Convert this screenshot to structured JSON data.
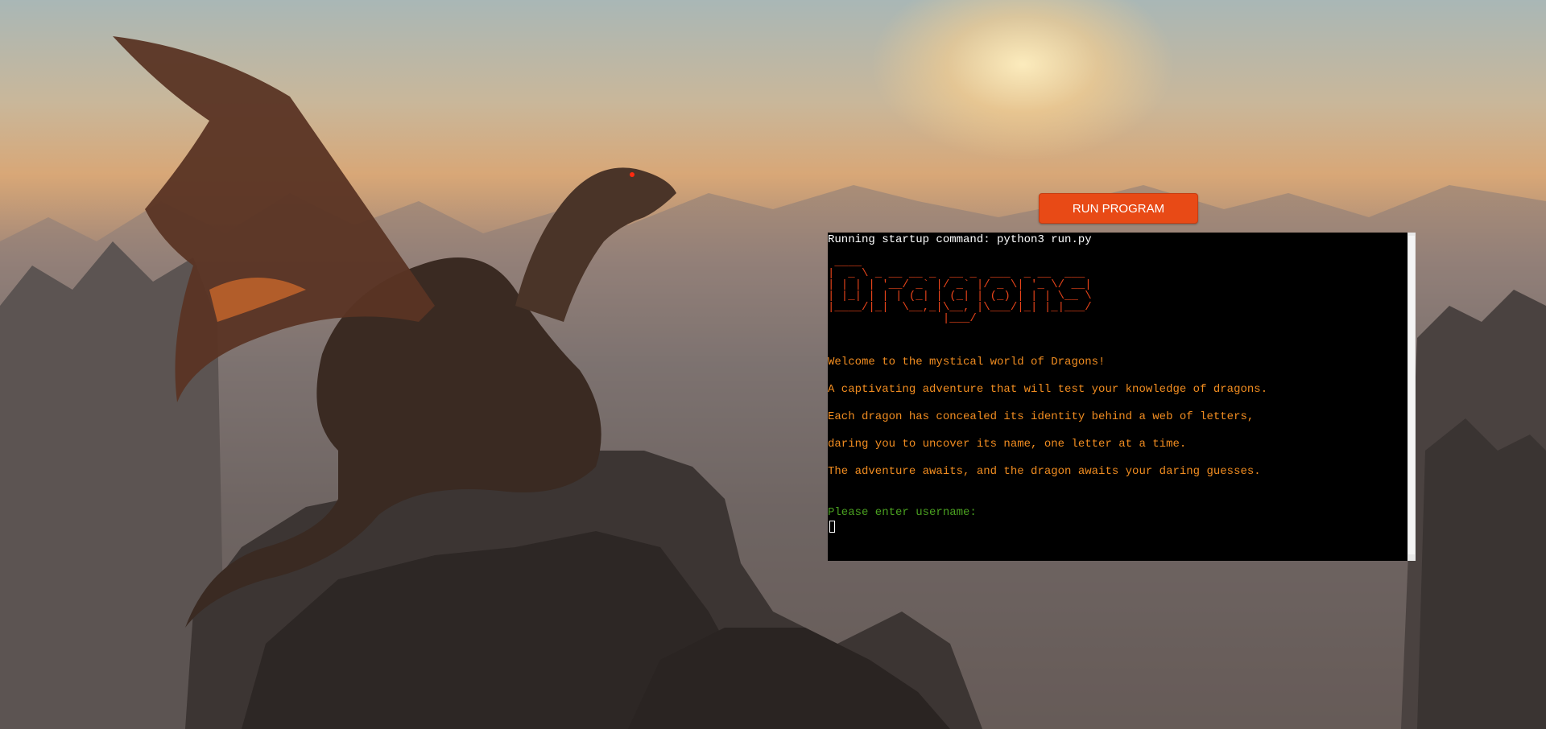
{
  "colors": {
    "button_bg": "#e84a16",
    "terminal_bg": "#000000",
    "ascii_title": "#e8441a",
    "intro_text": "#f08c20",
    "prompt_text": "#4aa020"
  },
  "toolbar": {
    "run_label": "RUN PROGRAM"
  },
  "terminal": {
    "startup_command": "Running startup command: python3 run.py",
    "ascii_title": " ____\n|  _ \\ _ __ __ _  __ _  ___  _ __  ___\n| | | | '__/ _` |/ _` |/ _ \\| '_ \\/ __|\n| |_| | | | (_| | (_| | (_) | | | \\__ \\\n|____/|_|  \\__,_|\\__, |\\___/|_| |_|___/\n                 |___/",
    "intro_lines": [
      "Welcome to the mystical world of Dragons!",
      "A captivating adventure that will test your knowledge of dragons.",
      "Each dragon has concealed its identity behind a web of letters,",
      "daring you to uncover its name, one letter at a time.",
      "The adventure awaits, and the dragon awaits your daring guesses."
    ],
    "prompt": "Please enter username:"
  }
}
